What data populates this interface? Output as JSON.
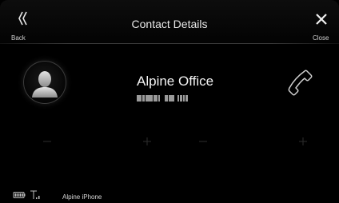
{
  "header": {
    "title": "Contact Details",
    "back_label": "Back",
    "close_label": "Close"
  },
  "contact": {
    "name": "Alpine Office",
    "avatar_icon": "person-silhouette-icon"
  },
  "actions": {
    "call_icon": "phone-handset-icon"
  },
  "slots": [
    {
      "icon": "minus-icon"
    },
    {
      "icon": "plus-icon"
    },
    {
      "icon": "minus-icon"
    },
    {
      "icon": "plus-icon"
    }
  ],
  "status": {
    "battery_icon": "battery-icon",
    "signal_icon": "signal-strength-icon",
    "device_name": "Alpine iPhone"
  },
  "colors": {
    "background": "#000000",
    "text": "#f2f2f2",
    "muted": "#2e2e2e"
  }
}
